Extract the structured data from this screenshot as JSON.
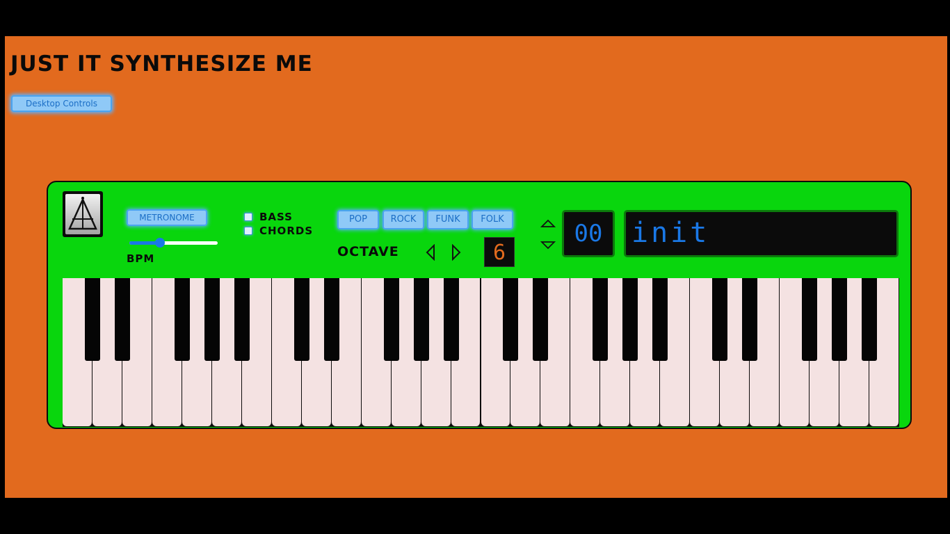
{
  "page": {
    "title": "JUST IT SYNTHESIZE ME",
    "desktop_controls_label": "Desktop Controls"
  },
  "synth": {
    "logo_icon": "metronome-icon",
    "metronome": {
      "button_label": "METRONOME",
      "bpm_label": "BPM",
      "bpm_slider_fraction": 0.35
    },
    "options": [
      {
        "label": "BASS",
        "checked": false
      },
      {
        "label": "CHORDS",
        "checked": false
      }
    ],
    "styles": [
      "POP",
      "ROCK",
      "FUNK",
      "FOLK"
    ],
    "octave": {
      "label": "OCTAVE",
      "value": "6",
      "prev_icon": "triangle-left-icon",
      "next_icon": "triangle-right-icon"
    },
    "patch": {
      "number": "00",
      "name": "init",
      "up_icon": "triangle-up-icon",
      "down_icon": "triangle-down-icon"
    },
    "keyboard": {
      "octaves": 4,
      "extra_white_keys": 0,
      "white_keys": 28
    }
  },
  "colors": {
    "page_background": "#e26a1e",
    "synth_body": "#09d60d",
    "display_text": "#1a78e6",
    "octave_display_text": "#e26a1e",
    "button_face": "#8fc9f7",
    "white_key": "#f4e2e2",
    "black_key": "#050505"
  }
}
